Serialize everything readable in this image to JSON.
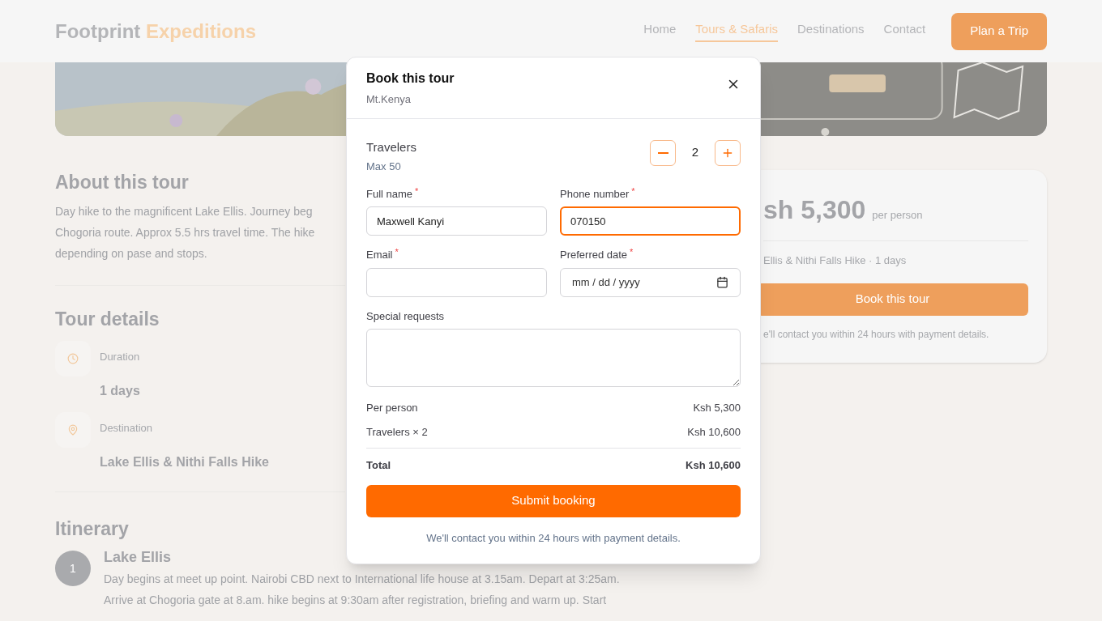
{
  "header": {
    "logo": {
      "first": "Footprint",
      "second": "Expeditions"
    },
    "nav": [
      {
        "label": "Home",
        "selected": false
      },
      {
        "label": "Tours & Safaris",
        "selected": true
      },
      {
        "label": "Destinations",
        "selected": false
      },
      {
        "label": "Contact",
        "selected": false
      }
    ],
    "cta": "Plan a Trip"
  },
  "about": {
    "title": "About this tour",
    "lines": [
      "Day hike to the magnificent Lake Ellis. Journey beg",
      "Chogoria route. Approx 5.5 hrs travel time. The hike",
      "depending on pase and stops."
    ]
  },
  "details": {
    "title": "Tour details",
    "items": [
      {
        "kind": "duration",
        "label": "Duration",
        "value": "1 days"
      },
      {
        "kind": "destination",
        "label": "Destination",
        "value": "Lake Ellis & Nithi Falls Hike"
      }
    ]
  },
  "itinerary": {
    "title": "Itinerary",
    "days": [
      {
        "number": "1",
        "title": "Lake Ellis",
        "lines": [
          "Day begins at meet up point. Nairobi CBD next to International life house at 3.15am. Depart at 3:25am.",
          "Arrive at Chogoria gate at 8.am. hike begins at 9:30am after registration, briefing and warm up. Start"
        ]
      }
    ]
  },
  "price_card": {
    "price": "sh 5,300",
    "unit": "per person",
    "summary": "Ellis & Nithi Falls Hike · 1 days",
    "button": "Book this tour",
    "note": "e'll contact you within 24 hours with payment details."
  },
  "modal": {
    "title": "Book this tour",
    "subtitle": "Mt.Kenya",
    "travelers": {
      "label": "Travelers",
      "hint": "Max 50",
      "count": "2"
    },
    "fields": [
      {
        "kind": "text",
        "label": "Full name",
        "required_mark": "*",
        "value": "Maxwell Kanyi",
        "focused": false
      },
      {
        "kind": "text",
        "label": "Phone number",
        "required_mark": "*",
        "value": "070150",
        "focused": true
      },
      {
        "kind": "text",
        "label": "Email",
        "required_mark": "*",
        "focused": false
      },
      {
        "kind": "date",
        "label": "Preferred date",
        "required_mark": "*",
        "placeholder": "mm / dd / yyyy",
        "focused": false
      },
      {
        "kind": "textarea",
        "label": "Special requests",
        "focused": false
      }
    ],
    "summary": [
      {
        "label": "Per person",
        "value": "Ksh 5,300"
      },
      {
        "label": "Travelers × 2",
        "value": "Ksh 10,600"
      }
    ],
    "total": {
      "label": "Total",
      "value": "Ksh 10,600"
    },
    "submit": "Submit booking",
    "note": "We'll contact you within 24 hours with payment details."
  }
}
